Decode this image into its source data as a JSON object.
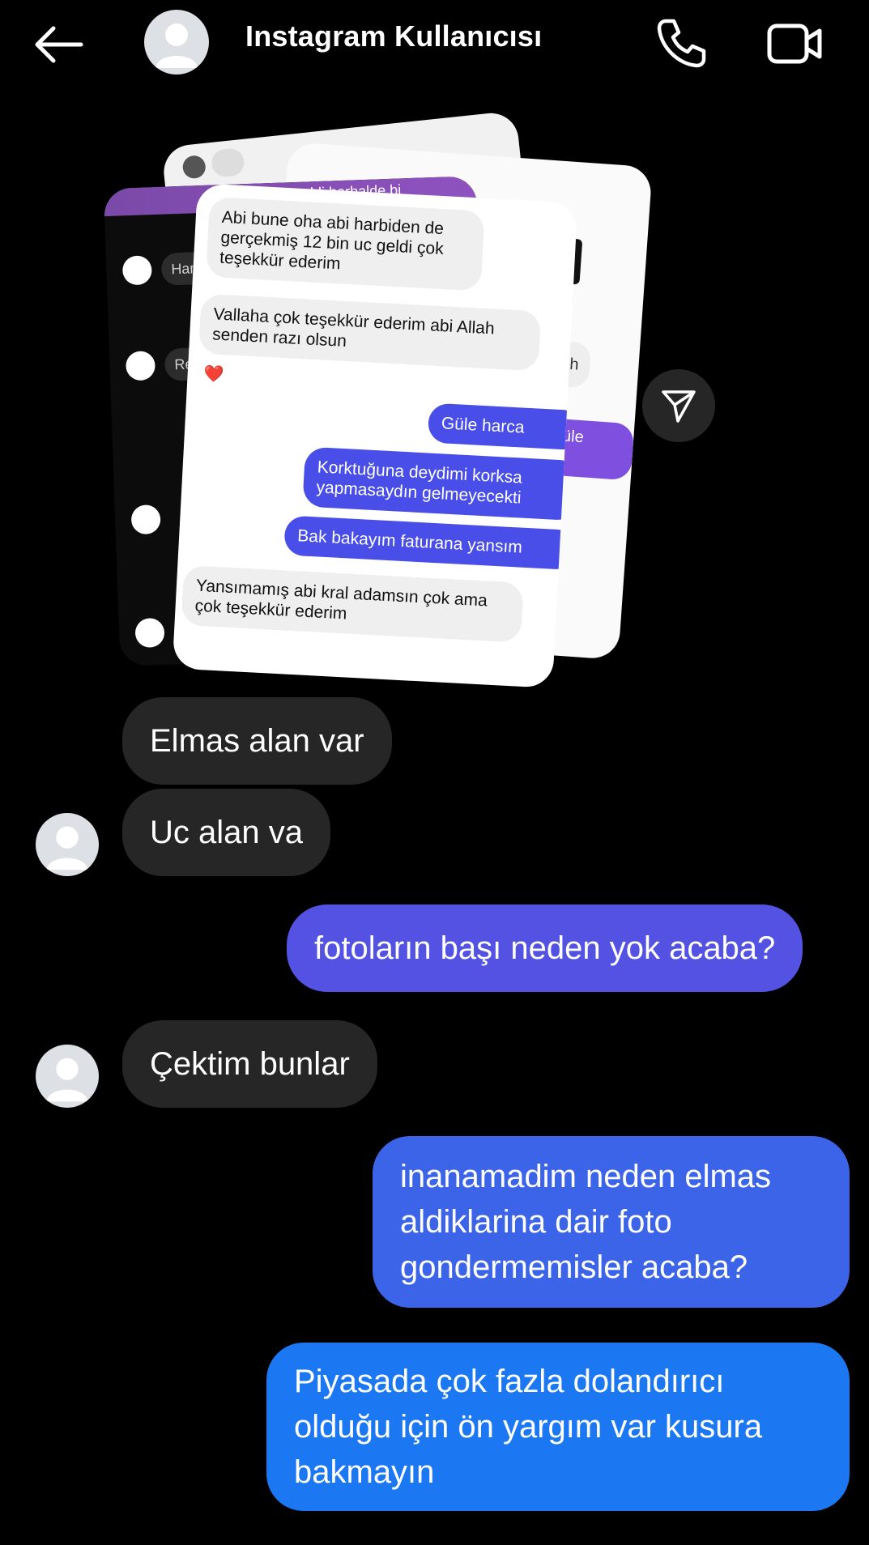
{
  "header": {
    "title": "Instagram Kullanıcısı",
    "icons": [
      "back-arrow-icon",
      "profile-avatar",
      "phone-icon",
      "video-camera-icon"
    ]
  },
  "shared_media": {
    "card_dark": {
      "top_text": "...ldi herhalde bi",
      "row1": "Ham",
      "row2": "Re"
    },
    "card_back": {
      "bold_text": "ler",
      "grey_text": "h",
      "purple_text": "e güle"
    },
    "card_front": {
      "messages": [
        {
          "text": "Abi bune oha abi harbiden de gerçekmiş 12 bin uc geldi çok teşekkür ederim"
        },
        {
          "text": "Vallaha çok teşekkür ederim abi Allah senden razı olsun"
        },
        {
          "text": "Güle harca"
        },
        {
          "text": "Korktuğuna deydimi korksa yapmasaydın gelmeyecekti"
        },
        {
          "text": "Bak bakayım faturana yansım"
        },
        {
          "text": "Yansımamış abi kral adamsın çok ama çok teşekkür ederim"
        }
      ],
      "reaction": "❤️"
    }
  },
  "messages": [
    {
      "direction": "incoming",
      "text": "Elmas alan var"
    },
    {
      "direction": "incoming",
      "text": "Uc alan va"
    },
    {
      "direction": "outgoing",
      "text": "fotoların başı neden yok acaba?"
    },
    {
      "direction": "incoming",
      "text": "Çektim bunlar"
    },
    {
      "direction": "outgoing",
      "text": "inanamadim neden elmas aldiklarina dair foto gondermemisler acaba?"
    },
    {
      "direction": "outgoing",
      "text": "Piyasada çok fazla dolandırıcı olduğu için ön yargım var kusura bakmayın"
    }
  ],
  "colors": {
    "background": "#000000",
    "incoming_bubble": "#262626",
    "outgoing_gradient": [
      "#5352e2",
      "#3b64e8",
      "#1b78f2"
    ]
  }
}
